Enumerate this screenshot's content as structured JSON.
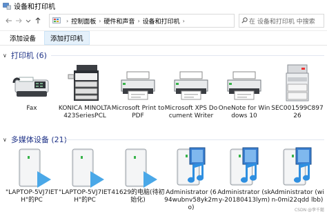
{
  "window": {
    "title": "设备和打印机"
  },
  "address": {
    "crumbs": [
      "控制面板",
      "硬件和声音",
      "设备和打印机"
    ],
    "search_placeholder": "在 设备和打印机 中搜索"
  },
  "toolbar": {
    "add_device": "添加设备",
    "add_printer": "添加打印机"
  },
  "printers": {
    "header": "打印机 (6)",
    "items": [
      {
        "label": "Fax",
        "icon": "fax-icon"
      },
      {
        "label": "KONICA MINOLTA 423SeriesPCL",
        "icon": "copier-icon"
      },
      {
        "label": "Microsoft Print to PDF",
        "icon": "printer-icon"
      },
      {
        "label": "Microsoft XPS Document Writer",
        "icon": "printer-icon"
      },
      {
        "label": "OneNote for Windows 10",
        "icon": "printer-icon"
      },
      {
        "label": "SEC001599C89726",
        "icon": "laser-printer-icon"
      }
    ]
  },
  "media": {
    "header": "多媒体设备 (21)",
    "items": [
      {
        "label": "\"LAPTOP-5VJ7IETH\"的PC",
        "icon": "media-server-icon"
      },
      {
        "label": "\"LAPTOP-5VJ7IETH\"的PC",
        "icon": "media-server-icon"
      },
      {
        "label": "41629的电脑(待初始化)",
        "icon": "media-server-icon"
      },
      {
        "label": "Administrator (694wubnv58yk2mo)",
        "icon": "media-player-icon"
      },
      {
        "label": "Administrator (sky-20180413lym)",
        "icon": "media-player-icon"
      },
      {
        "label": "Administrator (win-0mi22qdd lbb)",
        "icon": "media-player-icon"
      }
    ]
  },
  "watermark": "CSDN @李千懿",
  "colors": {
    "group_title": "#1e3287",
    "active_button_bg": "#e5f1fb",
    "play_arrow": "#4aa8e8"
  }
}
